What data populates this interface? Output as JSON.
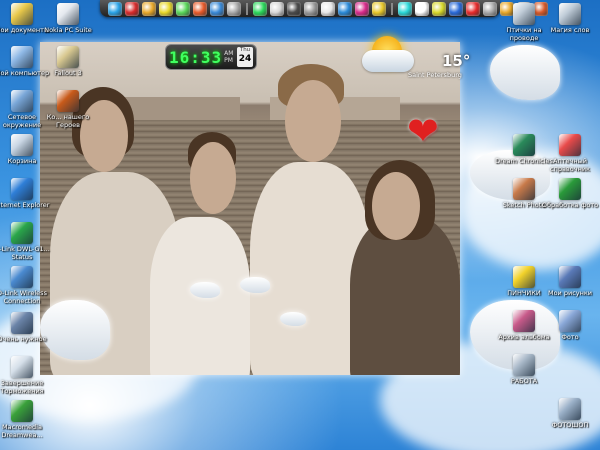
{
  "desktop": {
    "left_icons": [
      {
        "name": "my-documents-icon",
        "label": "Мои документы",
        "color": "#e8c84a"
      },
      {
        "name": "my-computer-icon",
        "label": "Мой компьютер",
        "color": "#8fb9e6"
      },
      {
        "name": "network-places-icon",
        "label": "Сетевое окружение",
        "color": "#7aa7d8"
      },
      {
        "name": "recycle-bin-icon",
        "label": "Корзина",
        "color": "#c9d6e4"
      },
      {
        "name": "internet-explorer-icon",
        "label": "Internet Explorer",
        "color": "#2f7fd8"
      },
      {
        "name": "dlink-status-icon",
        "label": "D-Link DWL-G1... Status",
        "color": "#2aa64a"
      },
      {
        "name": "dlink-connection-icon",
        "label": "D-Link Wireless Connection",
        "color": "#4a8ad0"
      },
      {
        "name": "folder-icon",
        "label": "Очень нужное",
        "color": "#6b84a8"
      },
      {
        "name": "shutdown-icon",
        "label": "Завершение Торможения",
        "color": "#d5dfe9"
      },
      {
        "name": "macromedia-dreamweaver-icon",
        "label": "Macromedia Dreamwea...",
        "color": "#3aa13a"
      }
    ],
    "mid_icons": [
      {
        "name": "nokia-pc-suite-icon",
        "label": "Nokia PC Suite",
        "color": "#e4e8ee"
      },
      {
        "name": "fallout-icon",
        "label": "Fallout 3",
        "color": "#d8c890"
      },
      {
        "name": "heroes-icon",
        "label": "Ко... нашего Героев",
        "color": "#c85a1a"
      }
    ],
    "right_icons": [
      {
        "name": "letters-icon",
        "label": "Птички на проводе",
        "color": "#c0ccd8"
      },
      {
        "name": "magic-words-icon",
        "label": "Магия слов",
        "color": "#c0ccd8"
      },
      {
        "name": "dream-chronicles-icon",
        "label": "Dream Chronicles",
        "color": "#2a8a5a"
      },
      {
        "name": "pharmacy-icon",
        "label": "Аптечный справочник",
        "color": "#e84a4a"
      },
      {
        "name": "photo-icon",
        "label": "Sketch Photo",
        "color": "#c87a4a"
      },
      {
        "name": "gallery-icon",
        "label": "Обработка фото",
        "color": "#2a9a3a"
      },
      {
        "name": "simpsons-icon",
        "label": "ПИНЧИКИ",
        "color": "#f2d22a"
      },
      {
        "name": "my-drawings-icon",
        "label": "Мои рисунки",
        "color": "#5a7ab8"
      },
      {
        "name": "archive-icon",
        "label": "Архив альбома",
        "color": "#c85a8a"
      },
      {
        "name": "photo-folder-icon",
        "label": "Фото",
        "color": "#8aa8d8"
      },
      {
        "name": "work-icon",
        "label": "РАБОТА",
        "color": "#a8b8c8"
      },
      {
        "name": "photoshop-icon",
        "label": "ФОТОШОП",
        "color": "#9ab0c8"
      }
    ]
  },
  "dock": {
    "icons": [
      "#2aa4e8",
      "#d82a2a",
      "#e8a82a",
      "#e8d82a",
      "#5ad85a",
      "#e85a2a",
      "#3a8ad8",
      "#aaaaaa",
      "#2ad85a",
      "#d8d8d8",
      "#4a4a4a",
      "#9a9a9a",
      "#e8e8e8",
      "#2a8ad8",
      "#d82a8a",
      "#e8c82a",
      "#2ad8d8",
      "#ffffff",
      "#d8d82a",
      "#2a6ad8",
      "#e82a2a",
      "#aaaaaa",
      "#e8a82a",
      "#c8c8c8",
      "#d85a2a"
    ]
  },
  "clock": {
    "time": "16:33",
    "day_name": "Thu",
    "day_number": "24"
  },
  "weather": {
    "temperature": "15°",
    "city": "Saint Petersburg"
  }
}
